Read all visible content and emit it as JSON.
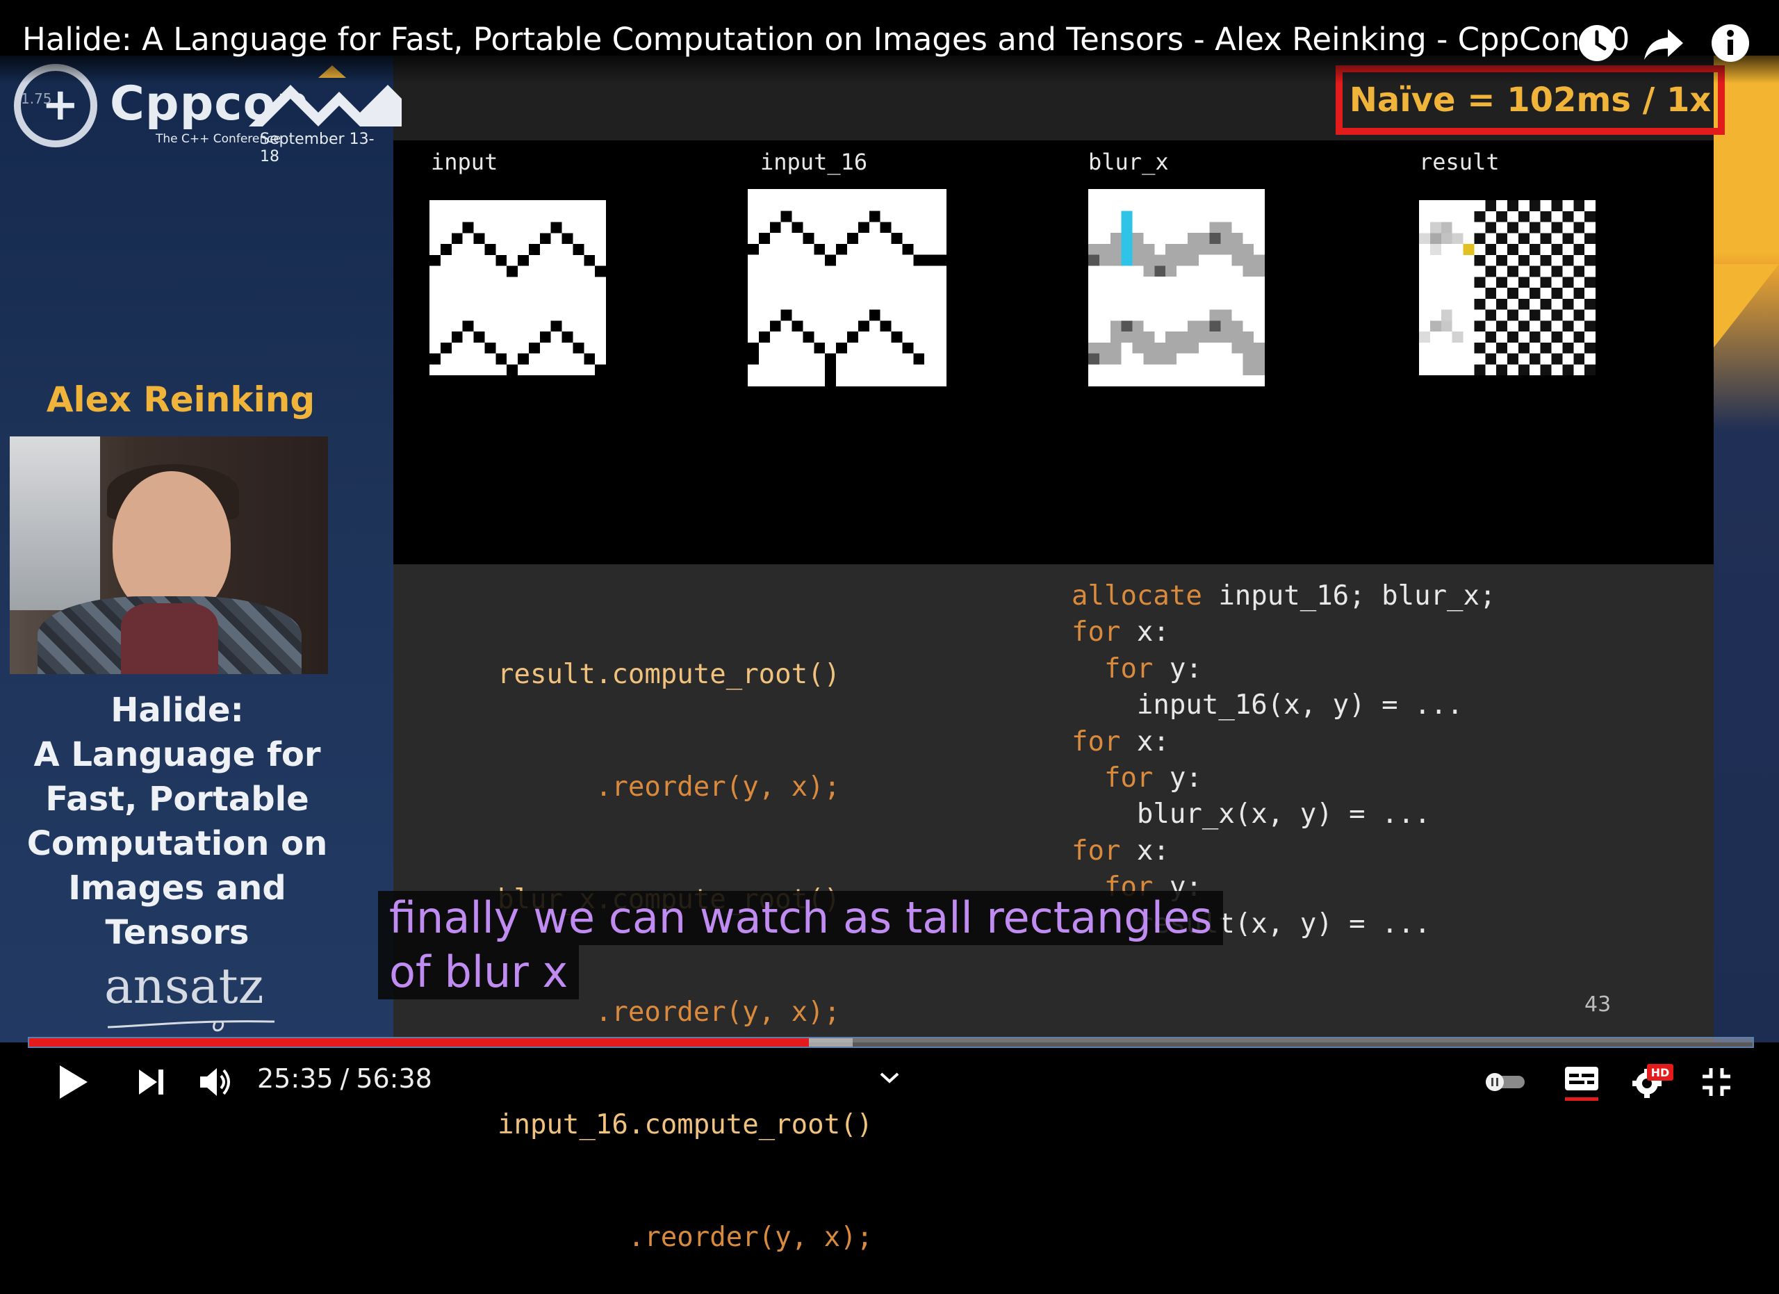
{
  "video": {
    "title": "Halide: A Language for Fast, Portable Computation on Images and Tensors - Alex Reinking - CppCon 20"
  },
  "top_icons": [
    "watch-later-icon",
    "share-icon",
    "info-icon"
  ],
  "conference": {
    "speed_overlay": "1.75",
    "brand": "Cppcon",
    "tagline": "The C++ Conference",
    "dates": "September 13-18"
  },
  "speaker": {
    "name": "Alex Reinking",
    "talk_title": [
      "Halide:",
      "A Language for",
      "Fast, Portable",
      "Computation on",
      "Images and",
      "Tensors"
    ],
    "sponsor": "ansatz"
  },
  "slide": {
    "badge": "Naïve = 102ms / 1x",
    "images": [
      {
        "label": "input"
      },
      {
        "label": "input_16"
      },
      {
        "label": "blur_x"
      },
      {
        "label": "result"
      }
    ],
    "schedule_code": [
      "result.compute_root()",
      "      .reorder(y, x);",
      "blur_x.compute_root()",
      "      .reorder(y, x);",
      "input_16.compute_root()",
      "        .reorder(y, x);"
    ],
    "loop_code": [
      {
        "kw": "allocate",
        "rest": " input_16; blur_x;"
      },
      {
        "kw": "for",
        "rest": " x:"
      },
      {
        "kw": "  for",
        "rest": " y:"
      },
      {
        "kw": "",
        "rest": "    input_16(x, y) = ..."
      },
      {
        "kw": "for",
        "rest": " x:"
      },
      {
        "kw": "  for",
        "rest": " y:"
      },
      {
        "kw": "",
        "rest": "    blur_x(x, y) = ..."
      },
      {
        "kw": "for",
        "rest": " x:"
      },
      {
        "kw": "  for",
        "rest": " y:"
      },
      {
        "kw": "",
        "rest": "    result(x, y) = ..."
      }
    ],
    "page_number": "43"
  },
  "captions": [
    "finally we can watch as tall rectangles",
    "of blur x"
  ],
  "player": {
    "current_time": "25:35",
    "separator": "/",
    "duration": "56:38",
    "progress_fraction": 0.4525,
    "buffered_fraction": 0.478,
    "controls_left": [
      "play-icon",
      "next-icon",
      "volume-icon"
    ],
    "controls_right": [
      "autoplay-toggle",
      "subtitles-icon",
      "settings-hd-icon",
      "exit-fullscreen-icon"
    ],
    "settings_badge": "HD",
    "accent": "#e51b1b"
  }
}
